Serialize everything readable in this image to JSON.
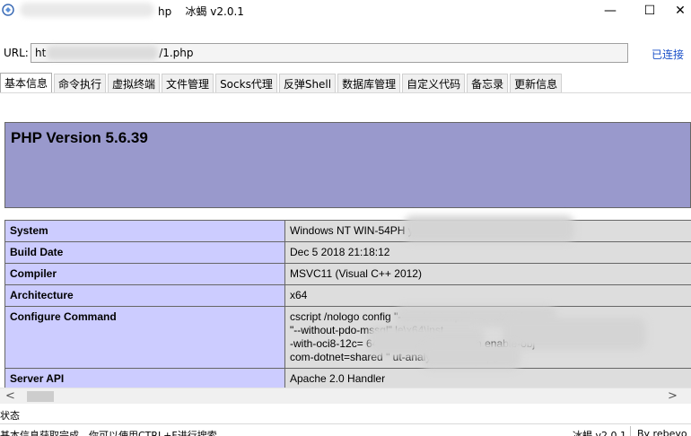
{
  "window": {
    "title_suffix": "hp    冰蝎 v2.0.1",
    "minimize_glyph": "—",
    "maximize_glyph": "☐",
    "close_glyph": "✕"
  },
  "url_bar": {
    "label": "URL:",
    "value": "ht                                 /1.php",
    "status_link": "已连接"
  },
  "tabs": [
    {
      "label": "基本信息",
      "active": true
    },
    {
      "label": "命令执行",
      "active": false
    },
    {
      "label": "虚拟终端",
      "active": false
    },
    {
      "label": "文件管理",
      "active": false
    },
    {
      "label": "Socks代理",
      "active": false
    },
    {
      "label": "反弹Shell",
      "active": false
    },
    {
      "label": "数据库管理",
      "active": false
    },
    {
      "label": "自定义代码",
      "active": false
    },
    {
      "label": "备忘录",
      "active": false
    },
    {
      "label": "更新信息",
      "active": false
    }
  ],
  "phpinfo": {
    "version_title": "PHP Version 5.6.39",
    "rows": [
      {
        "key": "System",
        "value": [
          "Windows NT WIN-54PH                                                    ys Server 2012 R2 Datac"
        ]
      },
      {
        "key": "Build Date",
        "value": [
          "Dec 5 2018 21:18:12"
        ]
      },
      {
        "key": "Compiler",
        "value": [
          "MSVC11 (Visual C++ 2012)"
        ]
      },
      {
        "key": "Architecture",
        "value": [
          "x64"
        ]
      },
      {
        "key": "Configure Command",
        "value": [
          "cscript /nologo config                                         \"--enable-isapi\" \"--enable-de",
          "\"--without-pdo-mssql\"                                                              le\\x64\\inst",
          "-with-oci8-12c=                       64\\instantcl     12_1\\sdk,sh          enable-obj",
          "com-dotnet=shared                         \"                                      ut-analyzer\" \"--with-pgo\""
        ]
      },
      {
        "key": "Server API",
        "value": [
          "Apache 2.0 Handler"
        ]
      }
    ]
  },
  "scrollbar": {
    "left_arrow": "<",
    "right_arrow": ">"
  },
  "status": {
    "title": "状态",
    "message": "基本信息获取完成，你可以使用CTRL+F进行搜索",
    "version_text": "冰蝎 v2.0.1",
    "author_text": "By rebeyo"
  },
  "colors": {
    "php_header_bg": "#9999cc",
    "key_cell_bg": "#ccccff",
    "value_cell_bg": "#dddddd",
    "link": "#1a50c8"
  }
}
